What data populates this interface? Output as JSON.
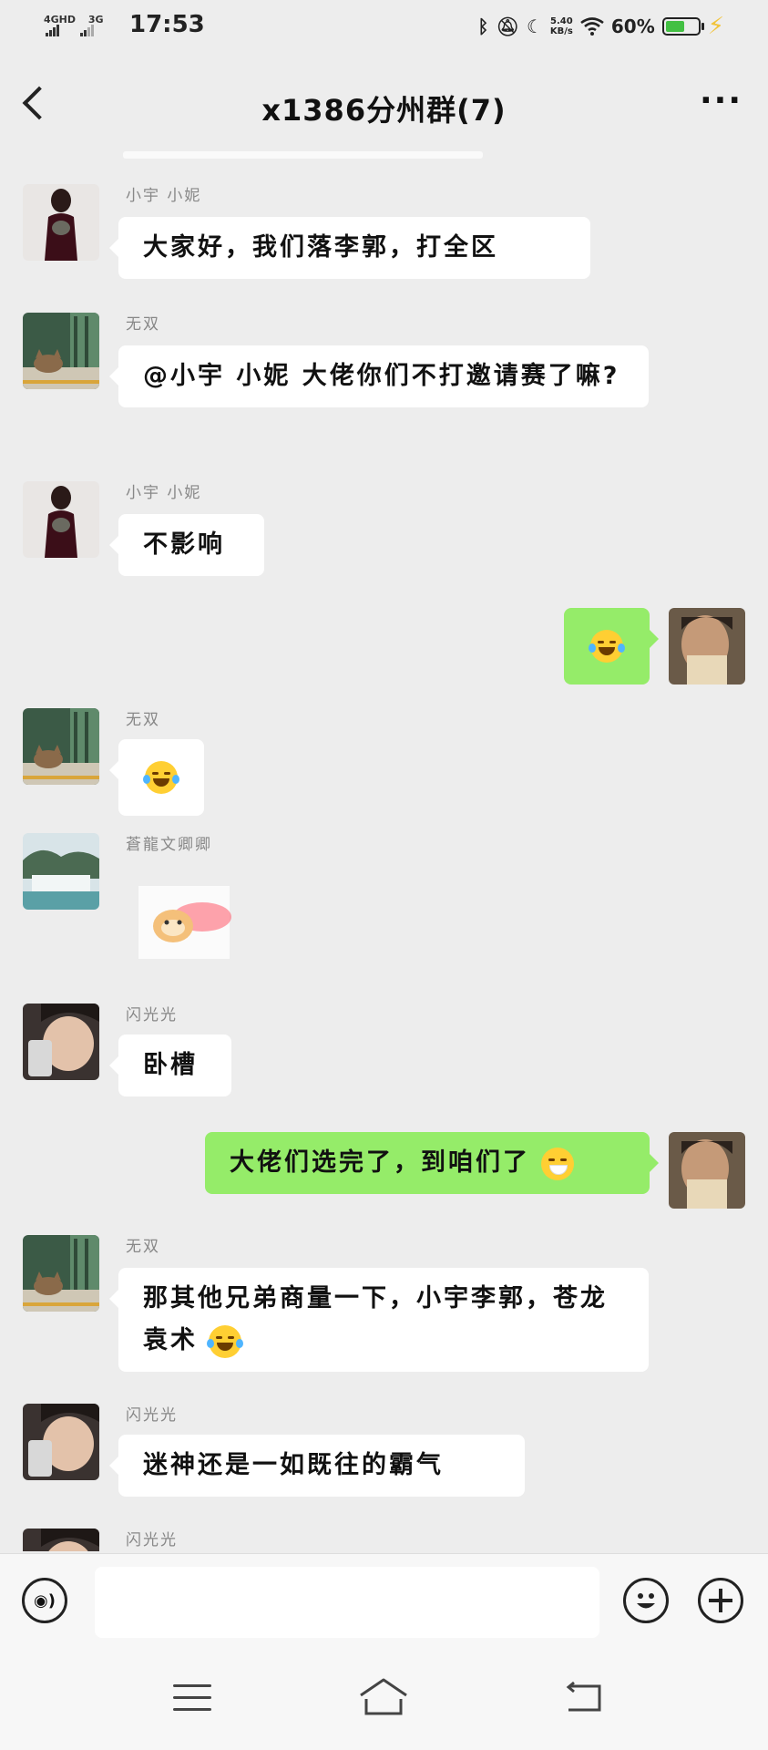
{
  "status_bar": {
    "network_top": "4GHD",
    "network_second": "3G",
    "time": "17:53",
    "speed_value": "5.40",
    "speed_unit": "KB/s",
    "battery_percent": "60%",
    "battery_level": 0.6,
    "icons": [
      "bluetooth-icon",
      "mute-icon",
      "moon-icon",
      "wifi-icon",
      "battery-icon",
      "charging-icon"
    ]
  },
  "header": {
    "title": "x1386分州群(7)",
    "more": "···"
  },
  "messages": [
    {
      "sender": "小宇 小妮",
      "text": "大家好，我们落李郭，打全区",
      "avatar": "avatar-xiaoyu"
    },
    {
      "sender": "无双",
      "text": "@小宇 小妮  大佬你们不打邀请赛了嘛?",
      "avatar": "avatar-wushuang"
    },
    {
      "sender": "小宇 小妮",
      "text": "不影响",
      "avatar": "avatar-xiaoyu"
    },
    {
      "sender": "",
      "text": "",
      "emoji": "laugh-cry-emoji",
      "avatar": "avatar-me"
    },
    {
      "sender": "无双",
      "text": "",
      "emoji": "laugh-cry-emoji",
      "avatar": "avatar-wushuang"
    },
    {
      "sender": "蒼龍文卿卿",
      "text": "",
      "sticker": "fire-cat-sticker",
      "avatar": "avatar-canglong"
    },
    {
      "sender": "闪光光",
      "text": "卧槽",
      "avatar": "avatar-shanguang"
    },
    {
      "sender": "",
      "text": "大佬们选完了，到咱们了",
      "emoji": "mask-emoji",
      "avatar": "avatar-me"
    },
    {
      "sender": "无双",
      "text": "那其他兄弟商量一下，小宇李郭，苍龙袁术",
      "emoji": "laugh-emoji",
      "avatar": "avatar-wushuang"
    },
    {
      "sender": "闪光光",
      "text": "迷神还是一如既往的霸气",
      "avatar": "avatar-shanguang"
    },
    {
      "sender": "闪光光",
      "text": "",
      "avatar": "avatar-shanguang"
    }
  ],
  "colors": {
    "background": "#ededed",
    "bubble_in": "#ffffff",
    "bubble_out": "#95ec69",
    "battery_fill": "#43c043"
  },
  "input_bar": {
    "voice_icon": "voice-icon",
    "emoji_icon": "emoji-icon",
    "plus_icon": "plus-icon",
    "placeholder": ""
  },
  "system_nav": [
    "menu-icon",
    "home-icon",
    "back-icon"
  ]
}
